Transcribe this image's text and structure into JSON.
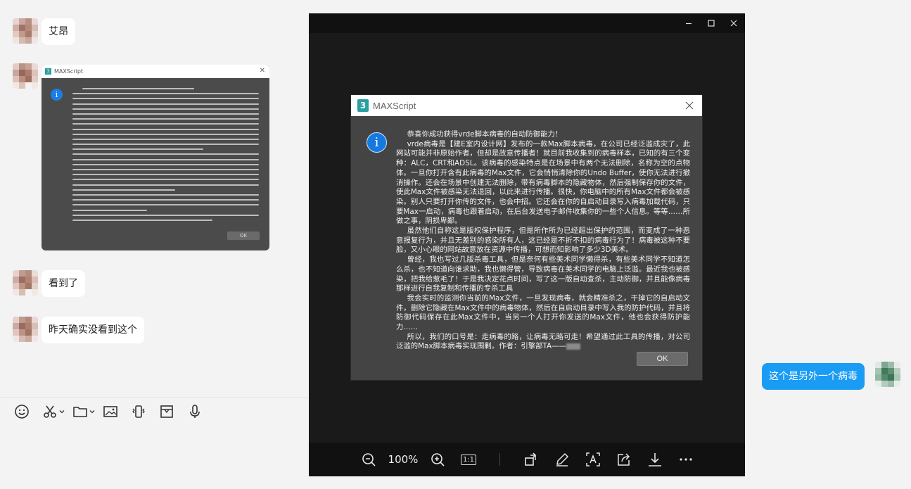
{
  "chat": {
    "messages": [
      {
        "text": "艾昂",
        "side": "left"
      },
      {
        "text": "看到了",
        "side": "left"
      },
      {
        "text": "昨天确实没看到这个",
        "side": "left"
      },
      {
        "text": "这个是另外一个病毒",
        "side": "right"
      }
    ],
    "thumbnail": {
      "title": "MAXScript",
      "ok_label": "OK"
    },
    "toolbar": [
      "emoji-icon",
      "scissors-icon",
      "folder-icon",
      "image-icon",
      "shake-icon",
      "box-icon",
      "microphone-icon"
    ]
  },
  "viewer": {
    "zoom": "100%",
    "actual_size_label": "1:1",
    "controls": [
      "minimize-icon",
      "maximize-icon",
      "close-icon"
    ],
    "tools": [
      "zoom-out-icon",
      "zoom-in-icon",
      "actual-size-icon",
      "rotate-icon",
      "edit-icon",
      "text-recognition-icon",
      "share-icon",
      "download-icon",
      "more-icon"
    ]
  },
  "dialog": {
    "title": "MAXScript",
    "ok_label": "OK",
    "paragraphs": [
      "恭喜你成功获得vrde脚本病毒的自动防御能力！",
      "vrde病毒是【建E室内设计网】发布的一款Max脚本病毒，在公司已经泛滥成灾了，此网站可能并非原始作者，但却是故意传播者！就目前我收集到的病毒样本，已知的有三个变种：ALC，CRT和ADSL。该病毒的感染特点是在场景中有两个无法删除，名称为空的点物体。一旦你打开含有此病毒的Max文件，它会悄悄清除你的Undo Buffer，使你无法进行撤消操作。还会在场景中创建无法删除，带有病毒脚本的隐藏物体，然后强制保存你的文件，使此Max文件被感染无法退回，以此来进行传播。很快，你电脑中的所有Max文件都会被感染。别人只要打开你传的文件，也会中招。它还会在你的自启动目录写入病毒加载代码，只要Max一启动，病毒也跟着启动，在后台发送电子邮件收集你的一些个人信息。等等……所做之事，阴损卑鄙。",
      "虽然他们自称这是版权保护程序，但是所作所为已经超出保护的范围，而变成了一种恶意报复行为，并且无差别的感染所有人，这已经是不折不扣的病毒行为了！病毒被这种不要脸，又小心眼的网站故意放在资源中传播，可想而知影响了多少3D美术。",
      "曾经，我也写过几版杀毒工具，但是奈何有些美术同学懒得杀，有些美术同学不知道怎么杀，也不知道向谁求助，我也懒得管，导致病毒在美术同学的电脑上泛滥。最近我也被感染，把我给惹毛了！于是我决定花点时间，写了这一版自动查杀，主动防御，并且能像病毒那样进行自我复制和传播的专杀工具",
      "我会实时的监测你当前的Max文件，一旦发现病毒，就会精准杀之，干掉它的自启动文件，删除它隐藏在Max文件中的病毒物体，然后在自启动目录中写入我的防护代码，并且将防御代码保存在此Max文件中，当另一个人打开你发送的Max文件，他也会获得防护能力……",
      "所以，我们的口号是：走病毒的路，让病毒无路可走！希望通过此工具的传播，对公司泛滥的Max脚本病毒实现围剿。作者：引擎部TA——"
    ]
  }
}
